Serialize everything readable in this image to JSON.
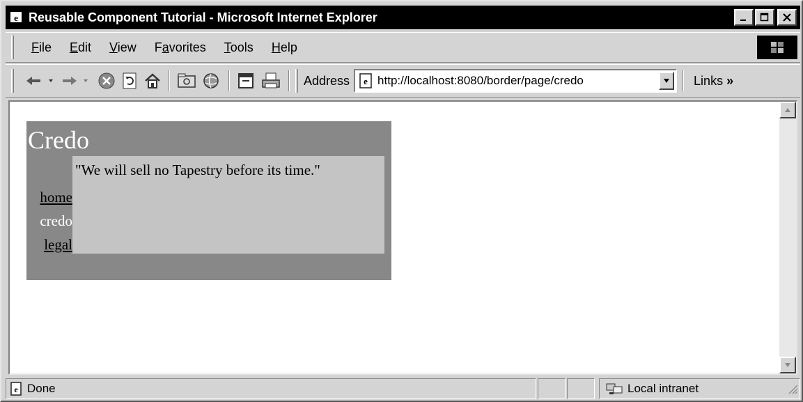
{
  "window": {
    "title": "Reusable Component Tutorial - Microsoft Internet Explorer"
  },
  "menu": {
    "items": [
      {
        "pre": "",
        "ul": "F",
        "post": "ile"
      },
      {
        "pre": "",
        "ul": "E",
        "post": "dit"
      },
      {
        "pre": "",
        "ul": "V",
        "post": "iew"
      },
      {
        "pre": "F",
        "ul": "a",
        "post": "vorites"
      },
      {
        "pre": "",
        "ul": "T",
        "post": "ools"
      },
      {
        "pre": "",
        "ul": "H",
        "post": "elp"
      }
    ]
  },
  "toolbar": {
    "address_label": "Address",
    "url": "http://localhost:8080/border/page/credo",
    "links_label": "Links"
  },
  "page": {
    "heading": "Credo",
    "nav": {
      "home": "home",
      "credo": "credo",
      "legal": "legal"
    },
    "body_text": "\"We will sell no Tapestry before its time.\""
  },
  "status": {
    "text": "Done",
    "zone": "Local intranet"
  },
  "colors": {
    "titlebar": "#000000",
    "chrome": "#d4d4d4",
    "border_table": "#888888",
    "body_box": "#c4c4c4"
  }
}
